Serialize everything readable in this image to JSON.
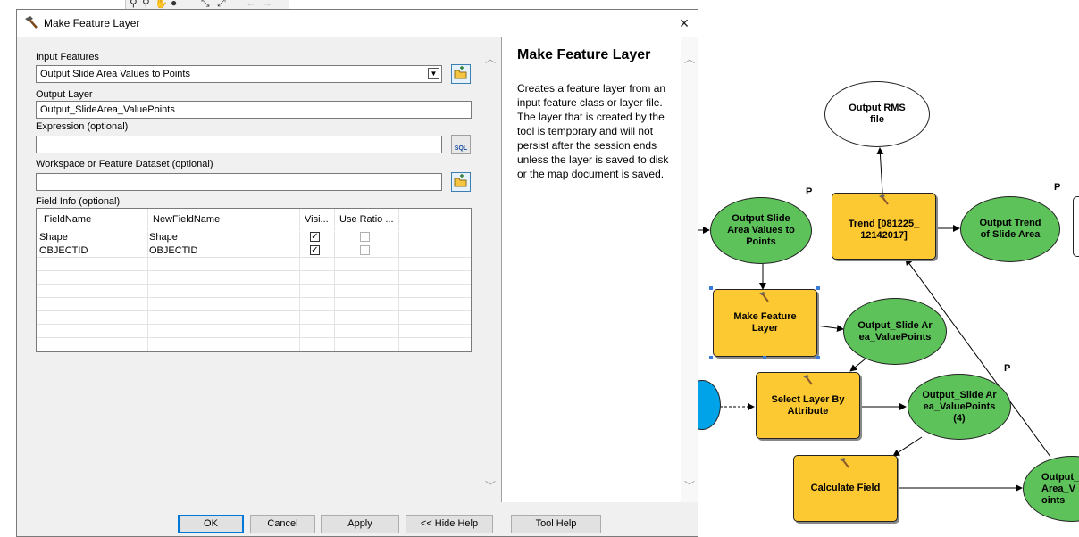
{
  "dialog": {
    "title": "Make Feature Layer",
    "close_label": "×"
  },
  "form": {
    "input_features_label": "Input Features",
    "input_features_value": "Output Slide Area Values to Points",
    "output_layer_label": "Output Layer",
    "output_layer_value": "Output_SlideArea_ValuePoints",
    "expression_label": "Expression (optional)",
    "expression_value": "",
    "workspace_label": "Workspace or Feature Dataset (optional)",
    "workspace_value": "",
    "field_info_label": "Field Info (optional)",
    "sql_label": "SQL"
  },
  "field_info": {
    "columns": [
      "FieldName",
      "NewFieldName",
      "Visi...",
      "Use Ratio ..."
    ],
    "rows": [
      {
        "field_name": "Shape",
        "new_field_name": "Shape",
        "visible": true,
        "use_ratio": false
      },
      {
        "field_name": "OBJECTID",
        "new_field_name": "OBJECTID",
        "visible": true,
        "use_ratio": false
      }
    ]
  },
  "help": {
    "title": "Make Feature Layer",
    "body": "Creates a feature layer from an input feature class or layer file. The layer that is created by the tool is temporary and will not persist after the session ends unless the layer is saved to disk or the map document is saved."
  },
  "buttons": {
    "ok": "OK",
    "cancel": "Cancel",
    "apply": "Apply",
    "hide_help": "<< Hide Help",
    "tool_help": "Tool Help"
  },
  "model": {
    "output_rms": "Output RMS file",
    "trend": "Trend [081225_12142017]",
    "output_slide_area_values": "Output Slide Area Values to Points",
    "output_trend": "Output Trend of Slide Area",
    "make_feature_layer": "Make Feature Layer",
    "output_slide_value_points": "Output_Slide Area_ValuePoints",
    "select_layer": "Select Layer By Attribute",
    "output_slide_value_points_4": "Output_Slide Area_ValuePoints (4)",
    "calculate_field": "Calculate Field",
    "output_partial": "Output_ Area_V oints",
    "p_tag": "P"
  },
  "colors": {
    "tool_fill": "#fdc932",
    "data_fill": "#5ec25a",
    "input_fill": "#00a2e8",
    "accent": "#0078d7"
  }
}
